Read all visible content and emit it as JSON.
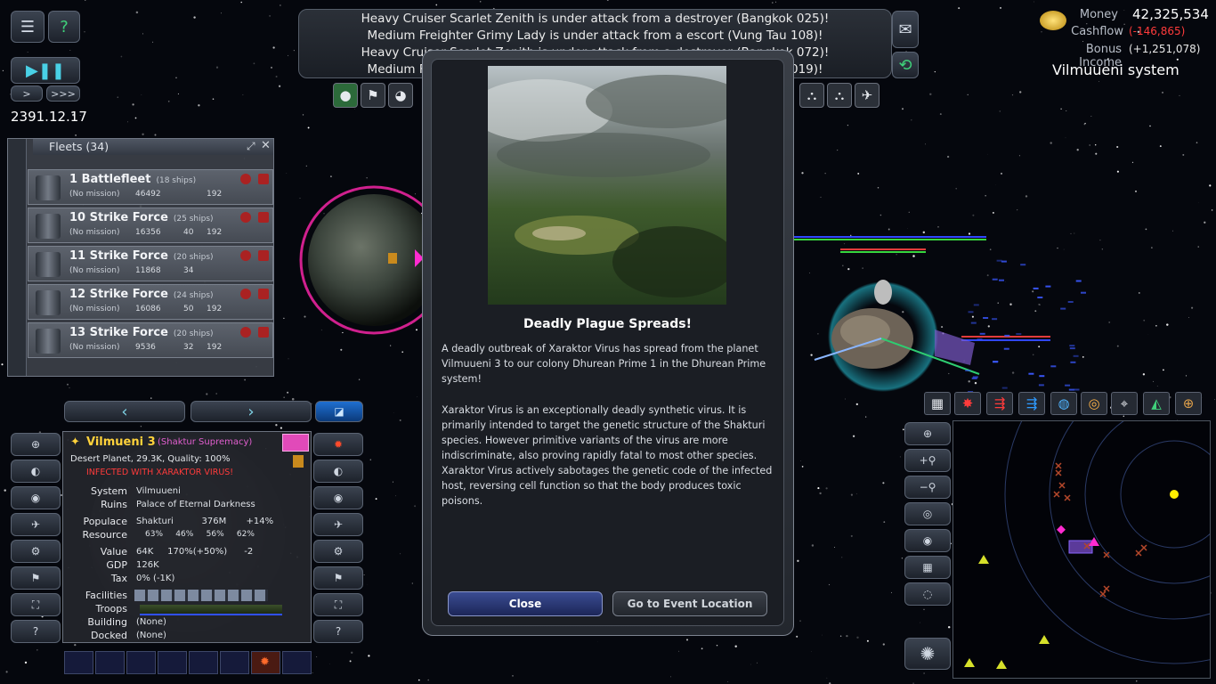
{
  "messages": [
    "Heavy Cruiser Scarlet Zenith is under attack from a destroyer (Bangkok 025)!",
    "Medium Freighter Grimy Lady is under attack from a escort (Vung Tau 108)!",
    "Heavy Cruiser Scarlet Zenith is under attack from a destroyer (Bangkok 072)!",
    "Medium Freighter Grimy Lady is under attack from a escort (Vung Tau 019)!"
  ],
  "game": {
    "date": "2391.12.17",
    "speed_buttons": [
      ">",
      ">>>"
    ]
  },
  "economy": {
    "money_label": "Money",
    "money_value": "42,325,534",
    "cashflow_label": "Cashflow",
    "cashflow_value": "(-146,865)",
    "bonus_label": "Bonus Income",
    "bonus_value": "(+1,251,078)",
    "system_name": "Vilmuueni system"
  },
  "fleets": {
    "title": "Fleets (34)",
    "items": [
      {
        "name": "1 Battlefleet",
        "ships": "(18 ships)",
        "mission": "(No mission)",
        "strength": "46492",
        "fuel": "",
        "range": "192"
      },
      {
        "name": "10 Strike Force",
        "ships": "(25 ships)",
        "mission": "(No mission)",
        "strength": "16356",
        "fuel": "40",
        "range": "192"
      },
      {
        "name": "11 Strike Force",
        "ships": "(20 ships)",
        "mission": "(No mission)",
        "strength": "11868",
        "fuel": "34",
        "range": ""
      },
      {
        "name": "12 Strike Force",
        "ships": "(24 ships)",
        "mission": "(No mission)",
        "strength": "16086",
        "fuel": "50",
        "range": "192"
      },
      {
        "name": "13 Strike Force",
        "ships": "(20 ships)",
        "mission": "(No mission)",
        "strength": "9536",
        "fuel": "32",
        "range": "192"
      }
    ]
  },
  "planet": {
    "name": "Vilmueni 3",
    "owner": "(Shaktur Supremacy)",
    "type": "Desert Planet, 29.3K,  Quality: 100%",
    "warning": "INFECTED WITH XARAKTOR VIRUS!",
    "rows": [
      {
        "label": "System",
        "value": "Vilmuueni"
      },
      {
        "label": "Ruins",
        "value": "Palace of Eternal Darkness"
      },
      {
        "label": "Populace",
        "value": "Shakturi          376M       +14%"
      },
      {
        "label": "Resource",
        "value": "63%     46%     56%     62%"
      },
      {
        "label": "Value",
        "value": "64K     170%(+50%)      -2"
      },
      {
        "label": "GDP",
        "value": "126K"
      },
      {
        "label": "Tax",
        "value": "0% (-1K)"
      },
      {
        "label": "Facilities",
        "value": ""
      },
      {
        "label": "Troops",
        "value": ""
      },
      {
        "label": "Building",
        "value": "(None)"
      },
      {
        "label": "Docked",
        "value": "(None)"
      }
    ]
  },
  "event": {
    "title": "Deadly Plague Spreads!",
    "paragraph1": "A deadly outbreak of Xaraktor Virus has spread from the planet Vilmuueni 3 to our colony Dhurean Prime 1 in the Dhurean Prime system!",
    "paragraph2": "Xaraktor Virus is an exceptionally deadly synthetic virus. It is primarily intended to target the genetic structure of the Shakturi species. However primitive variants of the virus are more indiscriminate, also proving rapidly fatal to most other species. Xaraktor Virus actively sabotages the genetic code of the infected host, reversing cell function so that the body produces toxic poisons.",
    "close_label": "Close",
    "goto_label": "Go to Event Location"
  },
  "colors": {
    "accent_magenta": "#ff2bd0",
    "warning_red": "#ff3b3b",
    "owner_pink": "#e25fd0",
    "close_button": "#2a3a7a"
  }
}
